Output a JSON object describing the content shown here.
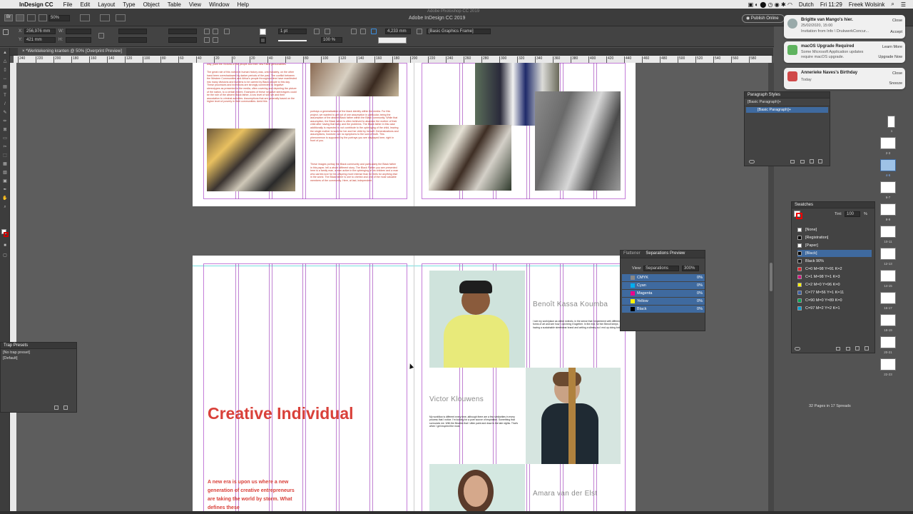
{
  "menubar": {
    "apple": "",
    "app": "InDesign CC",
    "items": [
      "File",
      "Edit",
      "Layout",
      "Type",
      "Object",
      "Table",
      "View",
      "Window",
      "Help"
    ],
    "language": "Dutch",
    "time": "Fri 11:29",
    "user": "Freek Wolsink"
  },
  "appbar": {
    "title": "Adobe InDesign CC 2019",
    "subtitle": "Adobe Photoshop CC 2019",
    "zoom": "50%",
    "publish_label": "Publish Online"
  },
  "control": {
    "x": "256,976 mm",
    "y": "421 mm",
    "stroke_weight": "1 pt",
    "size": "4,233 mm",
    "scale": "100 %",
    "frame_style": "[Basic Graphics Frame]"
  },
  "document": {
    "tab": "*Werktekening kranten @ 50% [Overprint Preview]"
  },
  "ruler_ticks": [
    "240",
    "220",
    "200",
    "180",
    "160",
    "140",
    "120",
    "100",
    "80",
    "60",
    "40",
    "20",
    "0",
    "20",
    "40",
    "60",
    "80",
    "100",
    "120",
    "140",
    "160",
    "180",
    "200",
    "220",
    "240",
    "260",
    "280",
    "300",
    "320",
    "340",
    "360",
    "380",
    "400",
    "420",
    "440",
    "460",
    "480",
    "500",
    "520",
    "540",
    "560",
    "580"
  ],
  "spread1": {
    "left_text_top": "way, plant the Victoria of the people and their new Fathe personalities.",
    "left_text_1": "The great role of this notion in human history was, unfortunately, on the other hand been overshadowed by darker periods of the past. The conflict between the Western Communities and Africa's people throughout time have manifested into many divisions and burdens to be carried by Black people to this day. These processes and inventions are strongly connected to negative stereotypes as presented in the media, often covering and depicting the picture of the nation, to a certain extent. Examples of these negative stereotypes could be the role of the absent Black father, a low level of skill set and their association to criminal activities. Assumptions that are generally based on the higher level of poverty in their communities. Amid this",
    "right_text_1": "portrays a generalization of the black identity within the media. For this project, we wanted to get out of one assumption in particular, being the assumption of the absent Black father within the Black community. While that assumption, the Black father is often believed to abandon the mother of their child after having that baby and the problems. The Black father in this case additionally is expected to not contribute to the upbringing of the child, leaving the single mother to work for her and her child by herself. Generalizations and assumptions, however, are no symptoms to the sum of truth. This phenomenon is supported by the portrays you see displayed here, right in front of you.",
    "right_text_2": "These images portray the Black community and particularly the Black father in this paper, tell a whole different story. The Black Father you see presented here is a family man, a man active in the upbringing of his children and a man who carries love for his offspring more intense than he feels for anything else in the world. The Black father is one to cherish and one of the most valuable members of the community. Here, at last, independent."
  },
  "spread2": {
    "heading": "Creative Individual",
    "intro": "A new era is upon us where a new generation of creative entrepreneurs are taking the world by storm. What defines these",
    "person1": {
      "name": "Benoît Kassa Koumba",
      "text": "I see my work/place as rather eclectic, in the sense that I experiment with different forms of art and see how I can bring it together. In the end, for him Benoit keeps having a sustainable streetwear brand and writing a slimmy so I end up doing both."
    },
    "person2": {
      "name": "Victor Klouwens",
      "text": "My workflow is different every time, although there are a few similarities in every process that I notice. I'm looking for a pure source of inspiration. Something that surrounds me. With the Beatles that I often paint and draw in the late nights. That's when I get inspired the most."
    },
    "person3": {
      "name": "Amara van der Elst"
    }
  },
  "notifications": [
    {
      "title": "Brigitte van Mango's hier.",
      "line2": "25/02/2020, 15:00",
      "line3": "Invitation from Info \\ DrukwerkConcur...",
      "btn1": "Close",
      "btn2": "Accept"
    },
    {
      "title": "macOS Upgrade Required",
      "line2": "Some Microsoft Application updates",
      "line3": "require macOS upgrade.",
      "btn1": "Learn More",
      "btn2": "Upgrade Now"
    },
    {
      "title": "Annerieke Naves's Birthday",
      "line2": "Today",
      "line3": "",
      "btn1": "Close",
      "btn2": "Snooze"
    }
  ],
  "paragraph_styles": {
    "title": "Paragraph Styles",
    "current": "[Basic Paragraph]+",
    "items": [
      "[Basic Paragraph]+"
    ]
  },
  "swatches": {
    "title": "Swatches",
    "tint_label": "Tint:",
    "tint_value": "100",
    "tint_unit": "%",
    "items": [
      {
        "name": "[None]",
        "color": "#ffffff"
      },
      {
        "name": "[Registration]",
        "color": "#000000"
      },
      {
        "name": "[Paper]",
        "color": "#ffffff"
      },
      {
        "name": "[Black]",
        "color": "#000000"
      },
      {
        "name": "Black 90%",
        "color": "#1a1a1a"
      },
      {
        "name": "C=0 M=98 Y=91 K=2",
        "color": "#e3262d"
      },
      {
        "name": "C=1 M=98 Y=1 K=3",
        "color": "#d6147f"
      },
      {
        "name": "C=2 M=0 Y=96 K=0",
        "color": "#fff200"
      },
      {
        "name": "C=77 M=56 Y=1 K=11",
        "color": "#3c5fa6"
      },
      {
        "name": "C=90 M=0 Y=89 K=0",
        "color": "#00a651"
      },
      {
        "name": "C=97 M=2 Y=2 K=1",
        "color": "#00a0d7"
      }
    ]
  },
  "separations": {
    "tab1": "Flattener",
    "tab2": "Separations Preview",
    "view_label": "View:",
    "view_value": "Separations",
    "zoom": "300%",
    "items": [
      {
        "name": "CMYK",
        "color": "#888888",
        "pct": "0%"
      },
      {
        "name": "Cyan",
        "color": "#00aeef",
        "pct": "0%"
      },
      {
        "name": "Magenta",
        "color": "#ec008c",
        "pct": "0%"
      },
      {
        "name": "Yellow",
        "color": "#fff200",
        "pct": "0%"
      },
      {
        "name": "Black",
        "color": "#000000",
        "pct": "0%"
      }
    ]
  },
  "trap_presets": {
    "title": "Trap Presets",
    "items": [
      "[No trap preset]",
      "[Default]"
    ]
  },
  "pages": {
    "summary": "32 Pages in 17 Spreads",
    "labels": [
      "1",
      "2-3",
      "4-5",
      "6-7",
      "8-9",
      "10-11",
      "12-13",
      "14-15",
      "16-17",
      "18-19",
      "20-21",
      "22-23"
    ]
  },
  "colors": {
    "accent_red": "#d9413a",
    "guide_purple": "#a54bbf"
  }
}
